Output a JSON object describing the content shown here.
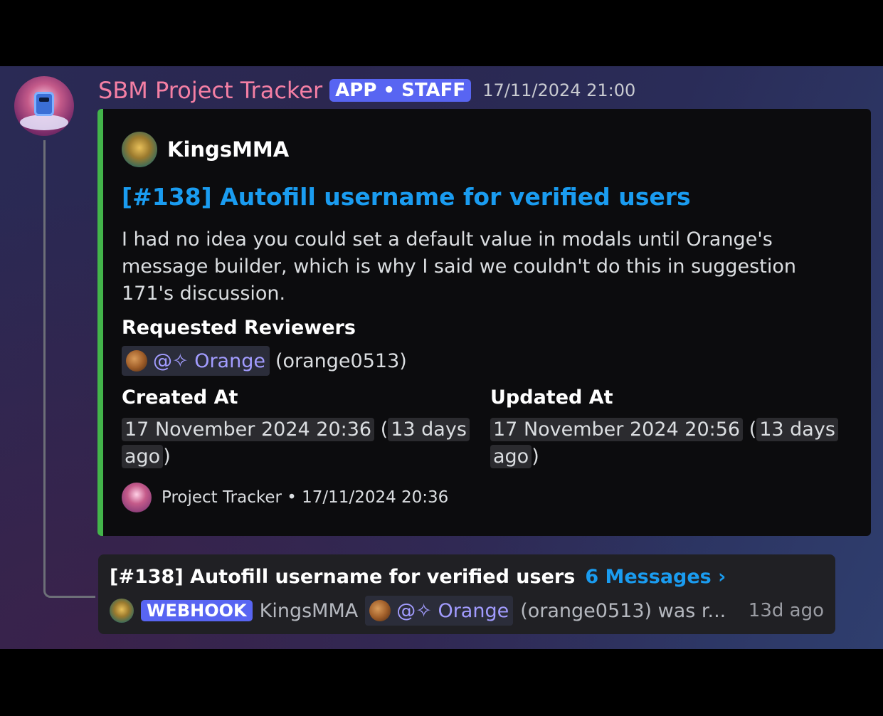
{
  "message": {
    "app_name": "SBM Project Tracker",
    "badge": "APP • STAFF",
    "timestamp": "17/11/2024 21:00"
  },
  "embed": {
    "accent_color": "#43b54a",
    "author": "KingsMMA",
    "title": "[#138] Autofill username for verified users",
    "description": "I had no idea you could set a default value in modals until Orange's message builder, which is why I said we couldn't do this in suggestion 171's discussion.",
    "fields": {
      "reviewers_label": "Requested Reviewers",
      "reviewer_mention": "@✧ Orange",
      "reviewer_username": "(orange0513)",
      "created_label": "Created At",
      "created_date": "17 November 2024 20:36",
      "created_relative": "13 days",
      "updated_label": "Updated At",
      "updated_date": "17 November 2024 20:56",
      "updated_relative": "13 days",
      "ago": "ago"
    },
    "footer": "Project Tracker • 17/11/2024 20:36"
  },
  "thread": {
    "title": "[#138] Autofill username for verified users",
    "messages_link": "6 Messages ›",
    "preview_badge": "WEBHOOK",
    "preview_author": "KingsMMA",
    "preview_mention": "@✧ Orange",
    "preview_text": "(orange0513) was r...",
    "preview_time": "13d ago"
  },
  "colors": {
    "app_name": "#f47fa4",
    "badge": "#5865f2",
    "link": "#1a9cf0",
    "mention": "#a29cff"
  }
}
